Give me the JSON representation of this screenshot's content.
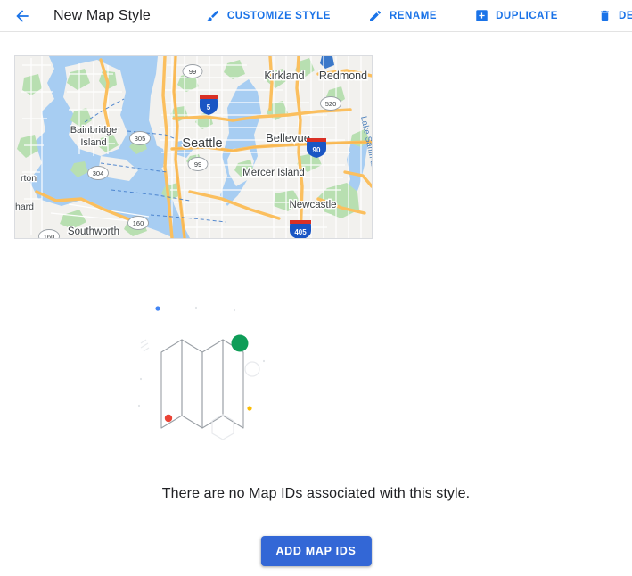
{
  "header": {
    "back_icon": "arrow-back-icon",
    "title": "New Map Style",
    "actions": [
      {
        "icon": "brush-icon",
        "label": "CUSTOMIZE STYLE"
      },
      {
        "icon": "pencil-icon",
        "label": "RENAME"
      },
      {
        "icon": "duplicate-icon",
        "label": "DUPLICATE"
      },
      {
        "icon": "trash-icon",
        "label": "DELETE"
      }
    ],
    "accent_color": "#1a73e8"
  },
  "map_preview": {
    "alt": "Map preview of Seattle area",
    "water_color": "#a7cdf2",
    "land_color": "#f2f1ee",
    "park_color": "#b8dfb1",
    "road_color": "#fbbf5e",
    "shield_blue": "#1a56c4",
    "labels": [
      "Bainbridge Island",
      "Seattle",
      "Kirkland",
      "Redmond",
      "Bellevue",
      "Mercer Island",
      "Newcastle",
      "Southworth",
      "Lake Sammamish",
      "rton",
      "hard"
    ],
    "route_shields": [
      "99",
      "5",
      "305",
      "304",
      "99",
      "160",
      "160",
      "520",
      "90",
      "405"
    ]
  },
  "empty_state": {
    "illustration": "folded-map-illustration",
    "message": "There are no Map IDs associated with this style.",
    "button_label": "ADD MAP IDS",
    "button_color": "#3367d6",
    "dots": {
      "blue": "#4285f4",
      "green": "#0f9d58",
      "red": "#ea4335",
      "yellow": "#fbbc04",
      "outline": "#e8eaed"
    }
  }
}
